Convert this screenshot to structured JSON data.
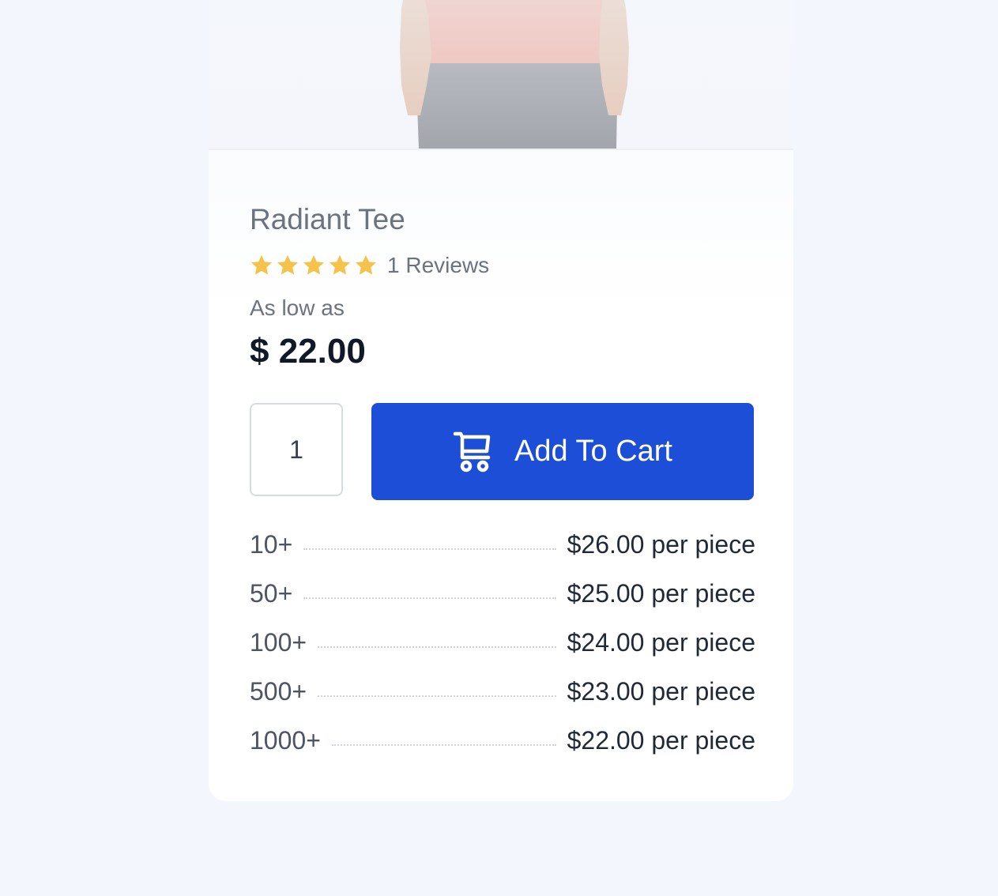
{
  "product": {
    "title": "Radiant Tee",
    "rating": {
      "stars": 5,
      "reviews_label": "1 Reviews"
    },
    "price_prefix": "As low as",
    "price": "$ 22.00",
    "image_icon": "model-wearing-tee"
  },
  "cart": {
    "quantity": "1",
    "button_label": "Add To Cart",
    "button_icon": "cart-icon"
  },
  "tier_prices": [
    {
      "qty": "10+",
      "price": "$26.00 per piece"
    },
    {
      "qty": "50+",
      "price": "$25.00 per piece"
    },
    {
      "qty": "100+",
      "price": "$24.00 per piece"
    },
    {
      "qty": "500+",
      "price": "$23.00 per piece"
    },
    {
      "qty": "1000+",
      "price": "$22.00 per piece"
    }
  ],
  "colors": {
    "accent": "#1d4ed8",
    "star": "#f5c24b",
    "background": "#f3f6fd"
  }
}
